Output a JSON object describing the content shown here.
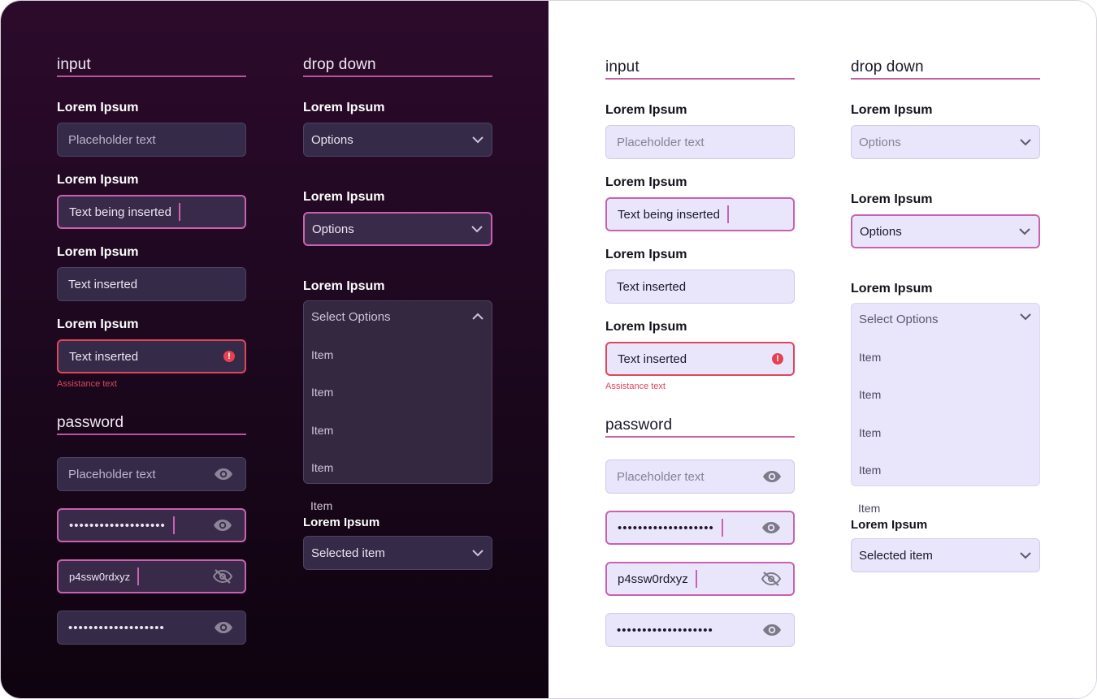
{
  "themes": {
    "dark": {
      "input_section": {
        "title": "input",
        "fields": [
          {
            "label": "Lorem Ipsum",
            "value": "Placeholder text",
            "state": "placeholder"
          },
          {
            "label": "Lorem Ipsum",
            "value": "Text being inserted",
            "state": "focused"
          },
          {
            "label": "Lorem Ipsum",
            "value": "Text inserted",
            "state": "filled"
          },
          {
            "label": "Lorem Ipsum",
            "value": "Text inserted",
            "state": "error",
            "assistance": "Assistance text"
          }
        ]
      },
      "password_section": {
        "title": "password",
        "fields": [
          {
            "value": "Placeholder text",
            "state": "placeholder",
            "icon": "eye-icon"
          },
          {
            "value": "•••••••••••••••••••",
            "state": "focused",
            "icon": "eye-icon"
          },
          {
            "value": "p4ssw0rdxyz",
            "state": "focused",
            "icon": "eye-off-icon"
          },
          {
            "value": "•••••••••••••••••••",
            "state": "filled",
            "icon": "eye-icon"
          }
        ]
      },
      "dropdown_section": {
        "title": "drop down",
        "closed": {
          "label": "Lorem Ipsum",
          "value": "Options"
        },
        "focused": {
          "label": "Lorem Ipsum",
          "value": "Options"
        },
        "open": {
          "label": "Lorem Ipsum",
          "header": "Select Options",
          "items": [
            "Item",
            "Item",
            "Item",
            "Item",
            "Item"
          ]
        },
        "selected": {
          "label": "Lorem Ipsum",
          "value": "Selected item"
        }
      }
    },
    "light": {
      "input_section": {
        "title": "input",
        "fields": [
          {
            "label": "Lorem Ipsum",
            "value": "Placeholder text",
            "state": "placeholder"
          },
          {
            "label": "Lorem Ipsum",
            "value": "Text being inserted",
            "state": "focused"
          },
          {
            "label": "Lorem Ipsum",
            "value": "Text inserted",
            "state": "filled"
          },
          {
            "label": "Lorem Ipsum",
            "value": "Text inserted",
            "state": "error",
            "assistance": "Assistance text"
          }
        ]
      },
      "password_section": {
        "title": "password",
        "fields": [
          {
            "value": "Placeholder text",
            "state": "placeholder",
            "icon": "eye-icon"
          },
          {
            "value": "•••••••••••••••••••",
            "state": "focused",
            "icon": "eye-icon"
          },
          {
            "value": "p4ssw0rdxyz",
            "state": "focused",
            "icon": "eye-off-icon"
          },
          {
            "value": "•••••••••••••••••••",
            "state": "filled",
            "icon": "eye-icon"
          }
        ]
      },
      "dropdown_section": {
        "title": "drop down",
        "closed": {
          "label": "Lorem Ipsum",
          "value": "Options"
        },
        "focused": {
          "label": "Lorem Ipsum",
          "value": "Options"
        },
        "open": {
          "label": "Lorem Ipsum",
          "header": "Select Options",
          "items": [
            "Item",
            "Item",
            "Item",
            "Item",
            "Item"
          ]
        },
        "selected": {
          "label": "Lorem Ipsum",
          "value": "Selected item"
        }
      }
    }
  },
  "colors": {
    "accent_pink": "#c862b0",
    "error_red": "#e0455b",
    "dark_bg_top": "#2c0a2b",
    "dark_bg_bottom": "#0e030f",
    "dark_field": "#352a47",
    "light_field": "#e9e6fb"
  }
}
